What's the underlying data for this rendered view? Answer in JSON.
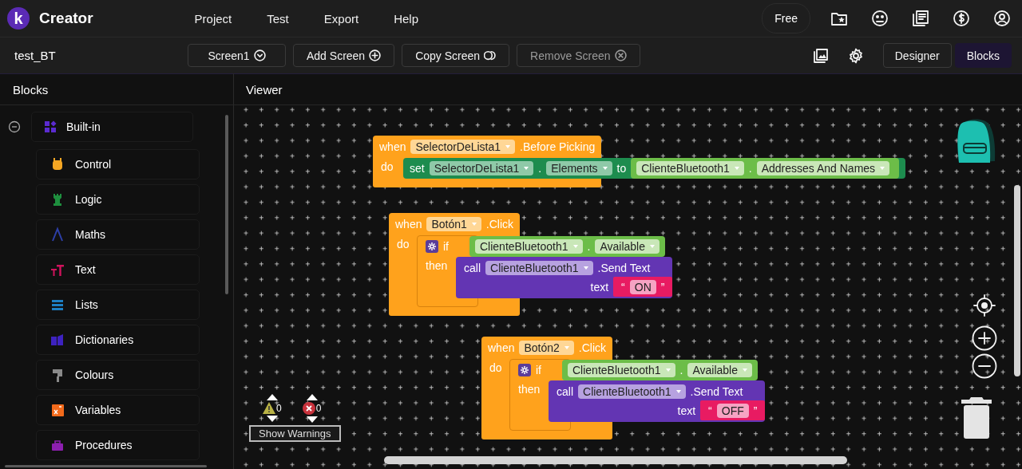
{
  "app": {
    "logo": "k",
    "name": "Creator"
  },
  "menu": [
    {
      "label": "Project"
    },
    {
      "label": "Test"
    },
    {
      "label": "Export"
    },
    {
      "label": "Help"
    }
  ],
  "plan_badge": "Free",
  "toolbar": {
    "project": "test_BT",
    "screen_buttons": [
      {
        "label": "Screen1",
        "kind": "dropdown",
        "disabled": false
      },
      {
        "label": "Add Screen",
        "kind": "add",
        "disabled": false
      },
      {
        "label": "Copy Screen",
        "kind": "copy",
        "disabled": false
      },
      {
        "label": "Remove Screen",
        "kind": "remove",
        "disabled": true
      }
    ],
    "view_tabs": [
      {
        "label": "Designer",
        "selected": false
      },
      {
        "label": "Blocks",
        "selected": true
      }
    ]
  },
  "sidebar": {
    "title": "Blocks",
    "group": {
      "label": "Built-in",
      "expanded": true,
      "color": "#5b2bd0"
    },
    "items": [
      {
        "label": "Control",
        "color": "#f5a623"
      },
      {
        "label": "Logic",
        "color": "#1e8f3e"
      },
      {
        "label": "Maths",
        "color": "#2d3fa8"
      },
      {
        "label": "Text",
        "color": "#d0135c"
      },
      {
        "label": "Lists",
        "color": "#1d7fc4"
      },
      {
        "label": "Dictionaries",
        "color": "#3d22c0"
      },
      {
        "label": "Colours",
        "color": "#8a8a8a"
      },
      {
        "label": "Variables",
        "color": "#f26a1b"
      },
      {
        "label": "Procedures",
        "color": "#8d1fb0"
      }
    ]
  },
  "viewer": {
    "title": "Viewer",
    "blocks": [
      {
        "kind": "event",
        "when": "when",
        "component": "SelectorDeLista1",
        "event": ".Before Picking",
        "do": "do",
        "statements": [
          {
            "kind": "set",
            "keyword": "set",
            "component": "SelectorDeLista1",
            "separator": ".",
            "property": "Elements",
            "to": "to",
            "value": {
              "kind": "getter",
              "component": "ClienteBluetooth1",
              "separator": ".",
              "property": "Addresses And Names"
            }
          }
        ]
      },
      {
        "kind": "event",
        "when": "when",
        "component": "Botón1",
        "event": ".Click",
        "do": "do",
        "statements": [
          {
            "kind": "if",
            "keyword": "if",
            "then": "then",
            "condition": {
              "kind": "getter",
              "component": "ClienteBluetooth1",
              "separator": ".",
              "property": "Available"
            },
            "body": [
              {
                "kind": "call",
                "keyword": "call",
                "component": "ClienteBluetooth1",
                "method": ".Send Text",
                "arg_label": "text",
                "arg": {
                  "kind": "text",
                  "open_quote": "“",
                  "value": "ON",
                  "close_quote": "”"
                }
              }
            ]
          }
        ]
      },
      {
        "kind": "event",
        "when": "when",
        "component": "Botón2",
        "event": ".Click",
        "do": "do",
        "statements": [
          {
            "kind": "if",
            "keyword": "if",
            "then": "then",
            "condition": {
              "kind": "getter",
              "component": "ClienteBluetooth1",
              "separator": ".",
              "property": "Available"
            },
            "body": [
              {
                "kind": "call",
                "keyword": "call",
                "component": "ClienteBluetooth1",
                "method": ".Send Text",
                "arg_label": "text",
                "arg": {
                  "kind": "text",
                  "open_quote": "“",
                  "value": "OFF",
                  "close_quote": "”"
                }
              }
            ]
          }
        ]
      }
    ],
    "warnings": {
      "warning_count": "0",
      "error_count": "0",
      "toggle": "Show Warnings"
    }
  }
}
